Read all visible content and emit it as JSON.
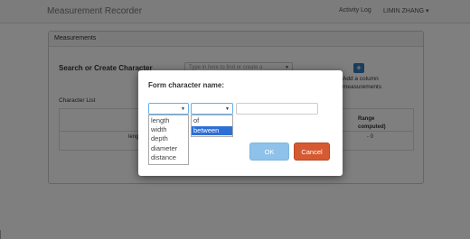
{
  "app": {
    "title": "Measurement Recorder"
  },
  "navbar": {
    "activity_log": "Activity Log",
    "user": "LIMIN ZHANG ▾"
  },
  "panel": {
    "title": "Measurements",
    "search_title": "Search or Create Character",
    "search_placeholder": "Type in here to find or create a",
    "add_label_line1": "Add a column",
    "add_label_line2": "measurements",
    "add_icon": "plus-icon",
    "list_label": "Character List"
  },
  "table": {
    "header_range": "Range",
    "header_computed": "computed)",
    "row_name": "leng",
    "row_value": "- 0"
  },
  "modal": {
    "title": "Form character name:",
    "select1_options": [
      "length",
      "width",
      "depth",
      "diameter",
      "distance"
    ],
    "select2_options": [
      "of",
      "between"
    ],
    "select2_selected": "between",
    "ok_label": "OK",
    "cancel_label": "Cancel"
  },
  "colors": {
    "accent": "#337ab7",
    "ok": "#8ec2ea",
    "cancel": "#d65a31",
    "option_highlight": "#2e6fd6"
  }
}
